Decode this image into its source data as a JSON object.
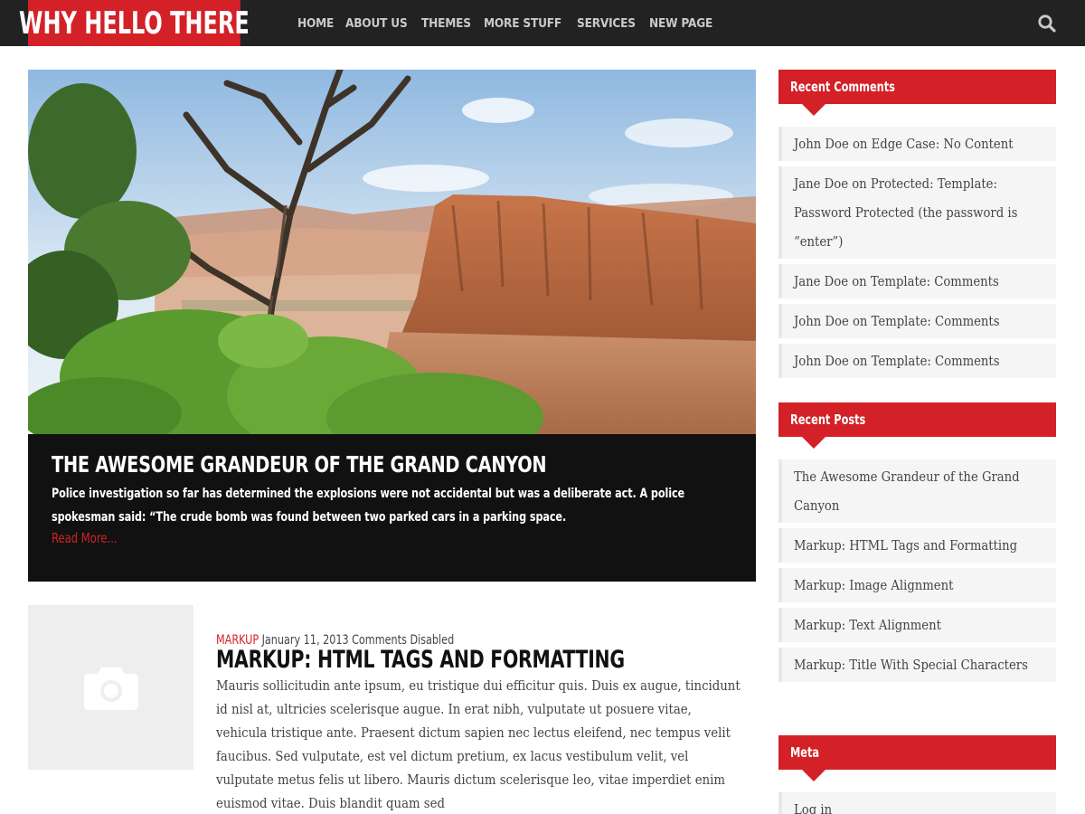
{
  "site": {
    "title": "WHY HELLO THERE",
    "brand_color": "#d32127"
  },
  "nav": {
    "items": [
      "HOME",
      "ABOUT US",
      "THEMES",
      "MORE STUFF",
      "SERVICES",
      "NEW PAGE"
    ],
    "search_icon": "search-icon"
  },
  "hero": {
    "title": "THE AWESOME GRANDEUR OF THE GRAND CANYON",
    "excerpt": "Police investigation so far has determined the explosions were not accidental but was a deliberate act. A police spokesman said: “The crude bomb was found between two parked cars in a parking space.",
    "read_more": "Read More..."
  },
  "post": {
    "category": "MARKUP",
    "date": "January 11, 2013",
    "comments": "Comments Disabled",
    "title": "MARKUP: HTML TAGS AND FORMATTING",
    "excerpt": "Mauris sollicitudin ante ipsum, eu tristique dui efficitur quis. Duis ex augue, tincidunt id nisl at, ultricies scelerisque augue. In erat nibh, vulputate ut posuere vitae, vehicula tristique ante. Praesent dictum sapien nec lectus eleifend, nec tempus velit faucibus. Sed vulputate, est vel dictum pretium, ex lacus vestibulum velit, vel vulputate metus felis ut libero. Mauris dictum scelerisque leo, vitae imperdiet enim euismod vitae. Duis blandit quam sed",
    "thumbnail_icon": "camera-icon"
  },
  "sidebar": {
    "recent_comments": {
      "title": "Recent Comments",
      "items": [
        "John Doe on Edge Case: No Content",
        "Jane Doe on Protected: Template: Password Protected (the password is “enter”)",
        "Jane Doe on Template: Comments",
        "John Doe on Template: Comments",
        "John Doe on Template: Comments"
      ]
    },
    "recent_posts": {
      "title": "Recent Posts",
      "items": [
        "The Awesome Grandeur of the Grand Canyon",
        "Markup: HTML Tags and Formatting",
        "Markup: Image Alignment",
        "Markup: Text Alignment",
        "Markup: Title With Special Characters"
      ]
    },
    "meta": {
      "title": "Meta",
      "items": [
        "Log in"
      ]
    }
  }
}
